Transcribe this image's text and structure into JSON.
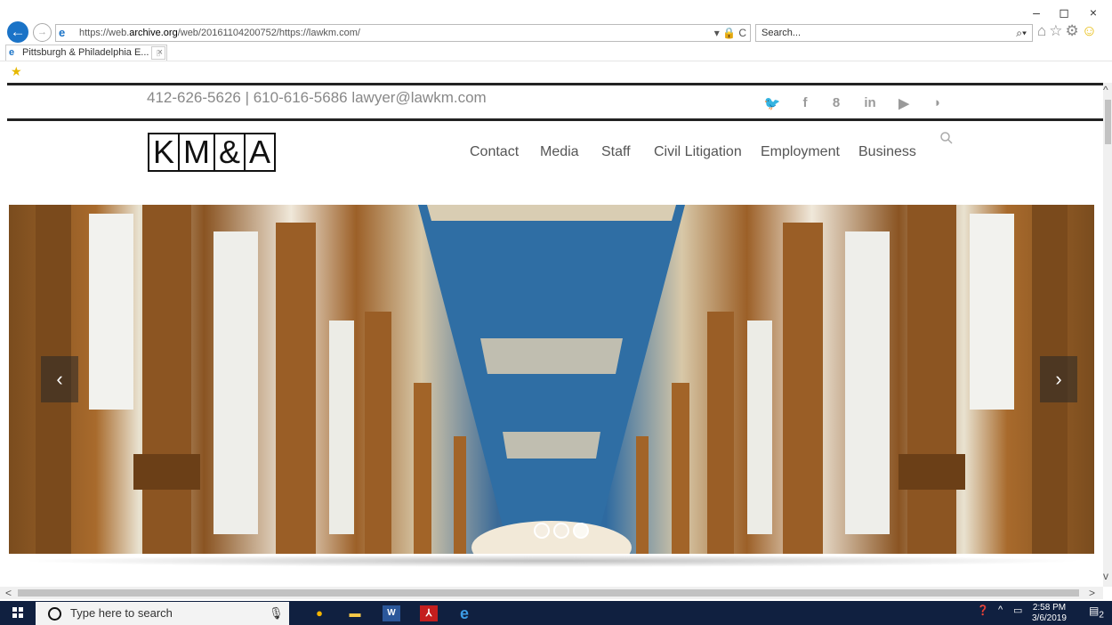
{
  "browser": {
    "url_prefix": "https://web.",
    "url_domain": "archive.org",
    "url_rest": "/web/20161104200752/https://lawkm.com/",
    "address_controls": "▾ 🔒 C",
    "search_placeholder": "Search...",
    "search_icon": "⌕▾",
    "tab_title": "Pittsburgh & Philadelphia E...",
    "tab_close": "×",
    "window_minimize": "–",
    "window_maximize": "◻",
    "window_close": "×"
  },
  "page": {
    "contact_line": "412-626-5626 | 610-616-5686 lawyer@lawkm.com",
    "social_icons": [
      "twitter-icon",
      "facebook-icon",
      "google-plus-icon",
      "linkedin-icon",
      "youtube-icon",
      "rss-icon"
    ],
    "social_glyphs": [
      "🐦",
      "f",
      "8",
      "in",
      "▶",
      "◗"
    ],
    "logo_letters": [
      "K",
      "M",
      "&",
      "A"
    ],
    "nav": [
      "Contact",
      "Media",
      "Staff",
      "Civil Litigation",
      "Employment",
      "Business"
    ],
    "slider_prev": "‹",
    "slider_next": "›",
    "slider_dots": 3,
    "active_dot": 2
  },
  "taskbar": {
    "search_placeholder": "Type here to search",
    "time": "2:58 PM",
    "date": "3/6/2019",
    "notification_count": "2",
    "apps": [
      "chrome-icon",
      "file-explorer-icon",
      "word-icon",
      "acrobat-icon",
      "internet-explorer-icon"
    ]
  },
  "colors": {
    "ie_blue": "#1a73c7",
    "taskbar": "#102040",
    "nav_text": "#555555",
    "rule": "#222222"
  }
}
